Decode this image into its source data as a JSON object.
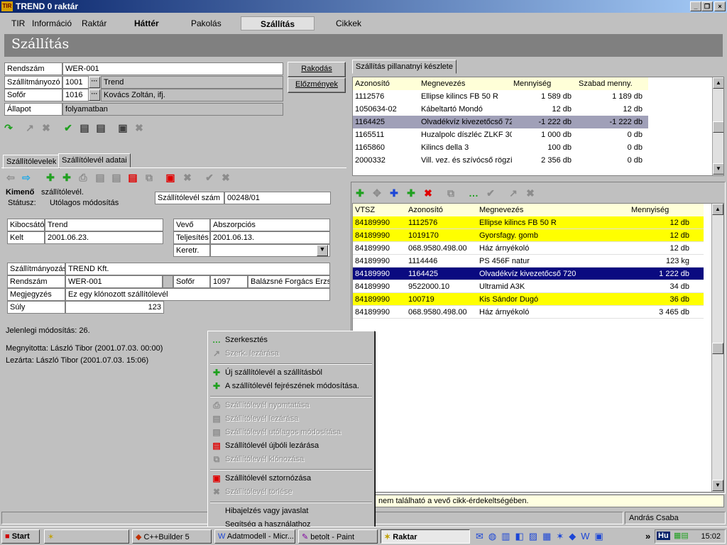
{
  "window": {
    "title": "TREND 0 raktár",
    "logo": "TIR"
  },
  "menu": [
    {
      "id": "tir",
      "label": "TIR"
    },
    {
      "id": "info",
      "label": "Információ"
    },
    {
      "id": "raktar",
      "label": "Raktár"
    },
    {
      "id": "hatter",
      "label": "Háttér"
    },
    {
      "id": "pakolas",
      "label": "Pakolás"
    },
    {
      "id": "szallitas",
      "label": "Szállítás"
    },
    {
      "id": "cikkek",
      "label": "Cikkek"
    }
  ],
  "page_title": "Szállítás",
  "form": {
    "rendszam_label": "Rendszám",
    "rendszam_value": "WER-001",
    "szallitmanyozo_label": "Szállítmányozó",
    "szallitmanyozo_code": "1001",
    "szallitmanyozo_name": "Trend",
    "sofor_label": "Sofőr",
    "sofor_code": "1016",
    "sofor_name": "Kovács Zoltán, ifj.",
    "allapot_label": "Állapot",
    "allapot_value": "folyamatban",
    "rakodas_button": "Rakodás",
    "elozmenyek_button": "Előzmények",
    "dots": "···"
  },
  "tabs": {
    "left": [
      "Szállítólevelek",
      "Szállítólevél adatai"
    ],
    "right": "Szállítás pillanatnyi készlete"
  },
  "detail": {
    "kimeno": "Kimenő",
    "szallitolevel": "szállítólevél.",
    "statusz_label": "Státusz:",
    "statusz_value": "Utólagos módosítás",
    "szam_label": "Szállítólevél szám",
    "szam_value": "00248/01",
    "kibocsato_label": "Kibocsátó",
    "kibocsato_value": "Trend",
    "kelt_label": "Kelt",
    "kelt_value": "2001.06.23.",
    "vevo_label": "Vevő",
    "vevo_value": "Abszorpciós",
    "teljesites_label": "Teljesítés",
    "teljesites_value": "2001.06.13.",
    "keretr_label": "Keretr.",
    "keretr_value": "",
    "szallitmanyozo_label": "Szállítmányozás",
    "szallitmanyozo_value": "TREND Kft.",
    "rendszam_label": "Rendszám",
    "rendszam_value": "WER-001",
    "sofor_label": "Sofőr",
    "sofor_code": "1097",
    "sofor_name": "Balázsné Forgács Erzs",
    "megjegyzes_label": "Megjegyzés",
    "megjegyzes_value": "Ez egy klónozott szállítólevél",
    "suly_label": "Súly",
    "suly_value": "123",
    "jelenlegi": "Jelenlegi módosítás: 26.",
    "megnyitotta": "Megnyitotta: László Tibor (2001.07.03. 00:00)",
    "lezarta": "Lezárta: László Tibor (2001.07.03. 15:06)"
  },
  "stock_table": {
    "columns": [
      "Azonosító",
      "Megnevezés",
      "Mennyiség",
      "Szabad menny."
    ],
    "rows": [
      {
        "id": "1112576",
        "name": "Ellipse kilincs  FB 50 R",
        "qty": "1 589 db",
        "free": "1 189 db"
      },
      {
        "id": "1050634-02",
        "name": "Kábeltartó Mondó",
        "qty": "12 db",
        "free": "12 db"
      },
      {
        "id": "1164425",
        "name": "Olvadékvíz kivezetőcső 72",
        "qty": "-1 222 db",
        "free": "-1 222 db"
      },
      {
        "id": "1165511",
        "name": "Huzalpolc díszléc ZLKF 30",
        "qty": "1 000 db",
        "free": "0 db"
      },
      {
        "id": "1165860",
        "name": "Kilincs della 3",
        "qty": "100 db",
        "free": "0 db"
      },
      {
        "id": "2000332",
        "name": "Vill. vez. és szívócső rögzít",
        "qty": "2 356 db",
        "free": "0 db"
      }
    ]
  },
  "items_table": {
    "columns": [
      "VTSZ",
      "Azonosító",
      "Megnevezés",
      "Mennyiség"
    ],
    "rows": [
      {
        "vtsz": "84189990",
        "id": "1112576",
        "name": "Ellipse kilincs  FB 50 R",
        "qty": "12 db",
        "style": "yellow"
      },
      {
        "vtsz": "84189990",
        "id": "1019170",
        "name": "Gyorsfagy. gomb",
        "qty": "12 db",
        "style": "yellow"
      },
      {
        "vtsz": "84189990",
        "id": "068.9580.498.00",
        "name": "Ház árnyékoló",
        "qty": "12 db",
        "style": "white"
      },
      {
        "vtsz": "84189990",
        "id": "1114446",
        "name": "PS 456F natur",
        "qty": "123 kg",
        "style": "white"
      },
      {
        "vtsz": "84189990",
        "id": "1164425",
        "name": "Olvadékvíz kivezetőcső 720",
        "qty": "1 222 db",
        "style": "selected"
      },
      {
        "vtsz": "84189990",
        "id": "9522000.10",
        "name": "Ultramid  A3K",
        "qty": "34 db",
        "style": "white"
      },
      {
        "vtsz": "84189990",
        "id": "100719",
        "name": "Kis Sándor Dugó",
        "qty": "36 db",
        "style": "yellow"
      },
      {
        "vtsz": "84189990",
        "id": "068.9580.498.00",
        "name": "Ház árnyékoló",
        "qty": "3 465 db",
        "style": "white"
      }
    ]
  },
  "hint_text": "nem található a vevő cikk-érdekeltségében.",
  "status_user": "András Csaba",
  "context_menu": [
    {
      "label": "Szerkesztés",
      "enabled": true,
      "icon": "dots-icon"
    },
    {
      "label": "Szerk. lezárása",
      "enabled": false,
      "icon": "arrow-icon"
    },
    {
      "label": "Új szállítólevél a szállításból",
      "enabled": true,
      "icon": "plus-icon"
    },
    {
      "label": "A szállítólevél fejrészének módosítása.",
      "enabled": true,
      "icon": "plus-edit-icon"
    },
    {
      "label": "Szállítólevél nyomtatása",
      "enabled": false,
      "icon": "printer-icon"
    },
    {
      "label": "Szállítólevél lezárása",
      "enabled": false,
      "icon": "doc-check-icon"
    },
    {
      "label": "Szállítólevél utólagos módosítása",
      "enabled": false,
      "icon": "doc-edit-icon"
    },
    {
      "label": "Szállítólevél újbóli lezárása",
      "enabled": true,
      "icon": "doc-lock-icon"
    },
    {
      "label": "Szállítólevél klónozása",
      "enabled": false,
      "icon": "clone-icon"
    },
    {
      "label": "Szállítólevél sztornózása",
      "enabled": true,
      "icon": "storno-icon"
    },
    {
      "label": "Szállítólevél törlése",
      "enabled": false,
      "icon": "delete-icon"
    },
    {
      "label": "Hibajelzés vagy javaslat",
      "enabled": true,
      "icon": ""
    },
    {
      "label": "Segítség a használathoz",
      "enabled": true,
      "icon": ""
    }
  ],
  "taskbar": {
    "start": "Start",
    "items": [
      "",
      "C++Builder 5",
      "Adatmodell - Micr...",
      "betolt - Paint",
      "Raktar"
    ],
    "lang": "Hu",
    "clock": "15:02",
    "more": "»"
  },
  "colors": {
    "yellow": "#ffff00",
    "selected": "#0a0a80",
    "stock_selected": "#a0a0b8",
    "header": "#808080"
  }
}
